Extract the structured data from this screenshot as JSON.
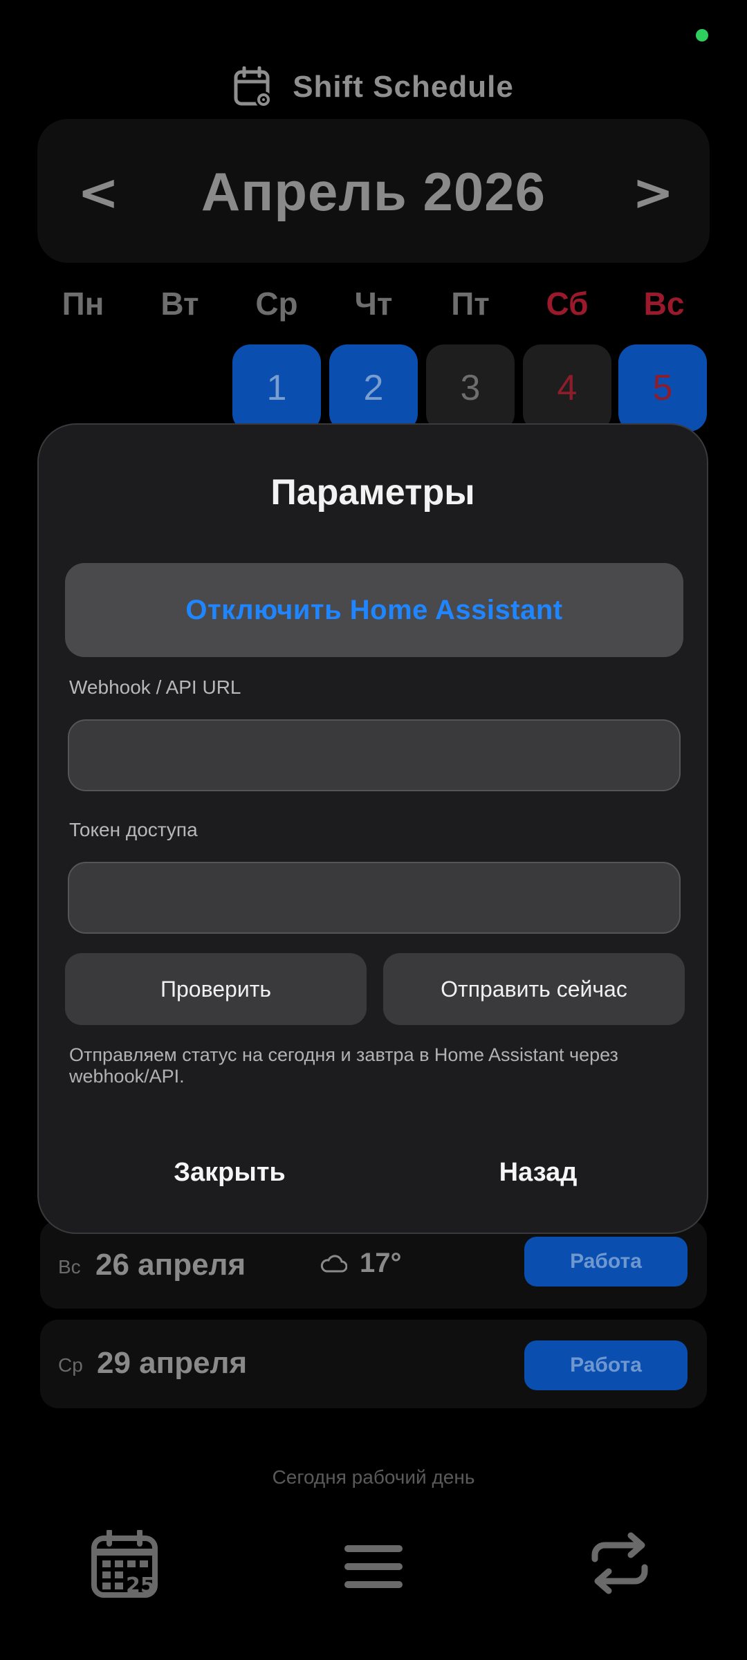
{
  "app": {
    "title": "Shift Schedule"
  },
  "calendar": {
    "month_title": "Апрель 2026",
    "prev_label": "<",
    "next_label": ">",
    "weekdays": [
      "Пн",
      "Вт",
      "Ср",
      "Чт",
      "Пт",
      "Сб",
      "Вс"
    ],
    "visible_days": [
      "1",
      "2",
      "3",
      "4",
      "5"
    ]
  },
  "modal": {
    "title": "Параметры",
    "disconnect_label": "Отключить Home Assistant",
    "webhook_label": "Webhook / API URL",
    "webhook_value": "",
    "token_label": "Токен доступа",
    "token_value": "",
    "check_label": "Проверить",
    "send_label": "Отправить сейчас",
    "hint": "Отправляем статус на сегодня и завтра в Home Assistant через webhook/API.",
    "close_label": "Закрыть",
    "back_label": "Назад"
  },
  "list": [
    {
      "dow": "Вс",
      "date": "26 апреля",
      "temp": "17°",
      "status": "Работа"
    },
    {
      "dow": "Ср",
      "date": "29 апреля",
      "status": "Работа"
    }
  ],
  "footer": {
    "today_text": "Сегодня рабочий день"
  },
  "colors": {
    "accent_blue": "#0a4fb0",
    "link_blue": "#1f86ff",
    "weekend_red": "#9a1a2c",
    "status_green": "#2fcf5e"
  },
  "icons": {
    "header": "calendar-gear-icon",
    "nav": [
      "calendar-icon",
      "menu-icon",
      "sync-icon"
    ],
    "weather": "cloud-icon"
  }
}
